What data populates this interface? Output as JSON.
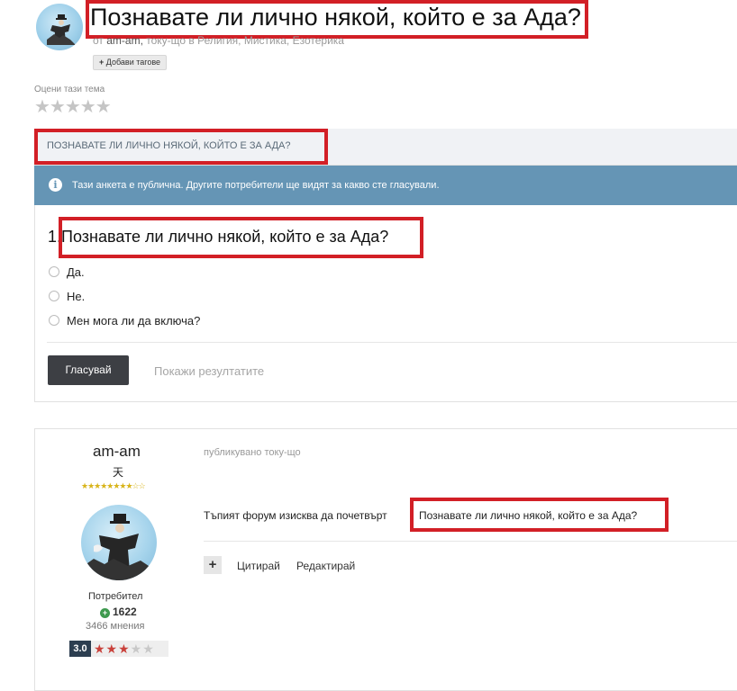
{
  "topic": {
    "title": "Познавате ли лично някой, който е за Ада?",
    "byline_prefix": "от",
    "author": "am-am,",
    "byline_suffix": "току-що в Религия, Мистика, Езотерика",
    "add_tags_label": "Добави тагове",
    "rate_label": "Оцени тази тема",
    "rating_stars": "★★★★★"
  },
  "poll": {
    "header": "ПОЗНАВАТЕ ЛИ ЛИЧНО НЯКОЙ, КОЙТО Е ЗА АДА?",
    "notice": "Тази анкета е публична. Другите потребители ще видят за какво сте гласували.",
    "question_number": "1.",
    "question": "Познавате ли лично някой, който е за Ада?",
    "options": [
      "Да.",
      "Не.",
      "Мен мога ли да включа?"
    ],
    "vote_label": "Гласувай",
    "results_label": "Покажи резултатите"
  },
  "post": {
    "username": "am-am",
    "rank_glyph": "天",
    "rank_stars": "★★★★★★★★☆☆",
    "role": "Потребител",
    "reputation": "1622",
    "posts_count": "3466 мнения",
    "score": "3.0",
    "score_stars_on": "★★★",
    "score_stars_off": "★★",
    "published": "публикувано току-що",
    "text_prefix": "Тъпият форум изисква да почетвърт",
    "text_highlight": "Познавате ли лично някой, който е за Ада?",
    "actions": {
      "plus": "+",
      "quote": "Цитирай",
      "edit": "Редактирай"
    }
  },
  "colors": {
    "highlight_border": "#d21f26",
    "notice_bg": "#6595b5",
    "vote_button_bg": "#3d3f44",
    "reputation_green": "#3e9a4e",
    "score_badge_bg": "#2c3e50"
  },
  "icons": [
    "user-avatar-icon",
    "info-icon",
    "radio-icon",
    "plus-icon",
    "star-icon"
  ]
}
